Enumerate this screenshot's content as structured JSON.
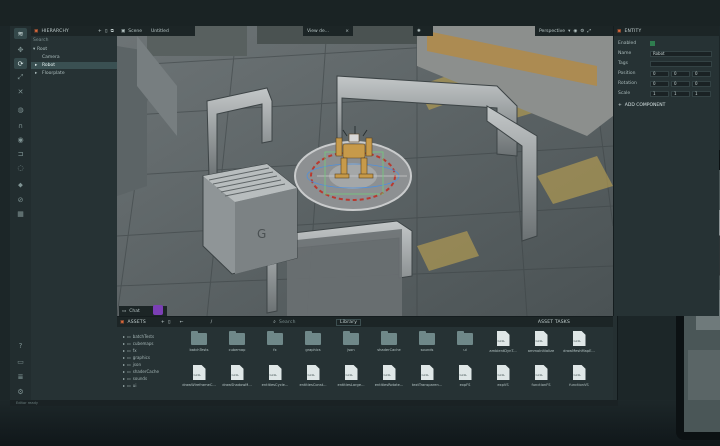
{
  "toolbar": {
    "icons": [
      "logo-icon",
      "move-icon",
      "rotate-icon",
      "scale-icon",
      "rect-tool-icon",
      "globe-icon",
      "magnet-icon",
      "eye-icon",
      "light-icon",
      "camera-icon",
      "pin-icon",
      "paint-icon",
      "grid-icon",
      "help-icon",
      "monitor-icon",
      "layers-icon",
      "settings-icon"
    ]
  },
  "hierarchy": {
    "title": "HIERARCHY",
    "search_placeholder": "Search",
    "items": [
      {
        "label": "Root",
        "depth": 0
      },
      {
        "label": "Camera",
        "depth": 1
      },
      {
        "label": "Robot",
        "depth": 1
      },
      {
        "label": "Floorplate",
        "depth": 1
      }
    ]
  },
  "scene": {
    "tabs": [
      "Scene",
      "Untitled",
      "View de..."
    ],
    "view_mode": "Perspective",
    "chat_label": "Chat"
  },
  "entity": {
    "title": "ENTITY",
    "enabled_label": "Enabled",
    "name_label": "Name",
    "name_value": "Robot",
    "tags_label": "Tags",
    "position_label": "Position",
    "rotation_label": "Rotation",
    "scale_label": "Scale",
    "position": [
      "0",
      "0",
      "0"
    ],
    "rotation": [
      "0",
      "0",
      "0"
    ],
    "scale": [
      "1",
      "1",
      "1"
    ],
    "add_component": "ADD COMPONENT"
  },
  "assets": {
    "title": "ASSETS",
    "path": "/",
    "search_placeholder": "Search",
    "library_label": "Library",
    "tasks_title": "ASSET TASKS",
    "tree": [
      "batchTests",
      "cubemaps",
      "fx",
      "graphics",
      "json",
      "shaderCache",
      "sounds",
      "ui"
    ],
    "row1": [
      {
        "label": "batchTests",
        "kind": "folder"
      },
      {
        "label": "cubemap",
        "kind": "folder"
      },
      {
        "label": "fx",
        "kind": "folder"
      },
      {
        "label": "graphics",
        "kind": "folder"
      },
      {
        "label": "json",
        "kind": "folder"
      },
      {
        "label": "shaderCache",
        "kind": "folder"
      },
      {
        "label": "sounds",
        "kind": "folder"
      },
      {
        "label": "ui",
        "kind": "folder"
      },
      {
        "label": "ambientDynT...",
        "kind": "file"
      },
      {
        "label": "ammoInitialize",
        "kind": "file"
      },
      {
        "label": "drawMeshMapE...",
        "kind": "file"
      }
    ],
    "row2": [
      {
        "label": "drawWireframeC...",
        "kind": "file"
      },
      {
        "label": "drawShadowM...",
        "kind": "file"
      },
      {
        "label": "entitiesCycle...",
        "kind": "file"
      },
      {
        "label": "entitiesConst...",
        "kind": "file"
      },
      {
        "label": "entitiesLarge...",
        "kind": "file"
      },
      {
        "label": "entitiesRotate...",
        "kind": "file"
      },
      {
        "label": "textTransparen...",
        "kind": "file"
      },
      {
        "label": "expFS",
        "kind": "file"
      },
      {
        "label": "expVS",
        "kind": "file"
      },
      {
        "label": "functionFS",
        "kind": "file"
      },
      {
        "label": "functionVS",
        "kind": "file"
      }
    ],
    "file_badge": "GLSL"
  },
  "status": {
    "text": "Editor ready"
  }
}
